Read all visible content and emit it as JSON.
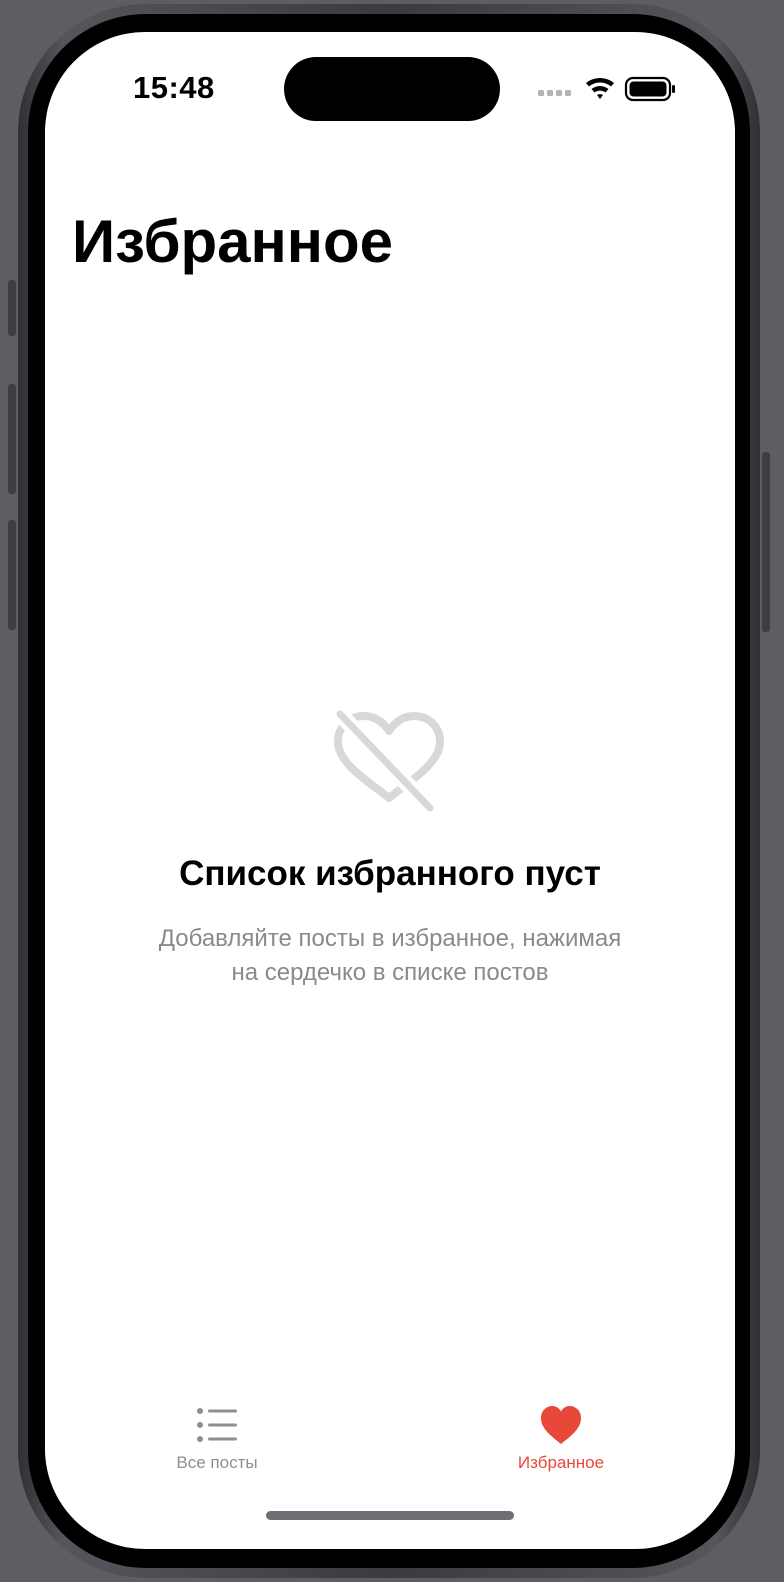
{
  "status_bar": {
    "time": "15:48"
  },
  "header": {
    "title": "Избранное"
  },
  "empty_state": {
    "icon": "heart-slash-icon",
    "title": "Список избранного пуст",
    "subtitle_line1": "Добавляйте посты в избранное, нажимая",
    "subtitle_line2": "на сердечко в списке постов"
  },
  "tab_bar": {
    "tabs": [
      {
        "label": "Все посты",
        "icon": "list-icon",
        "selected": false
      },
      {
        "label": "Избранное",
        "icon": "heart-icon",
        "selected": true
      }
    ]
  },
  "colors": {
    "accent": "#e8483a",
    "inactive": "#8e8e93",
    "subtitle": "#8a8a8e",
    "empty_icon": "#d8d8d8"
  }
}
